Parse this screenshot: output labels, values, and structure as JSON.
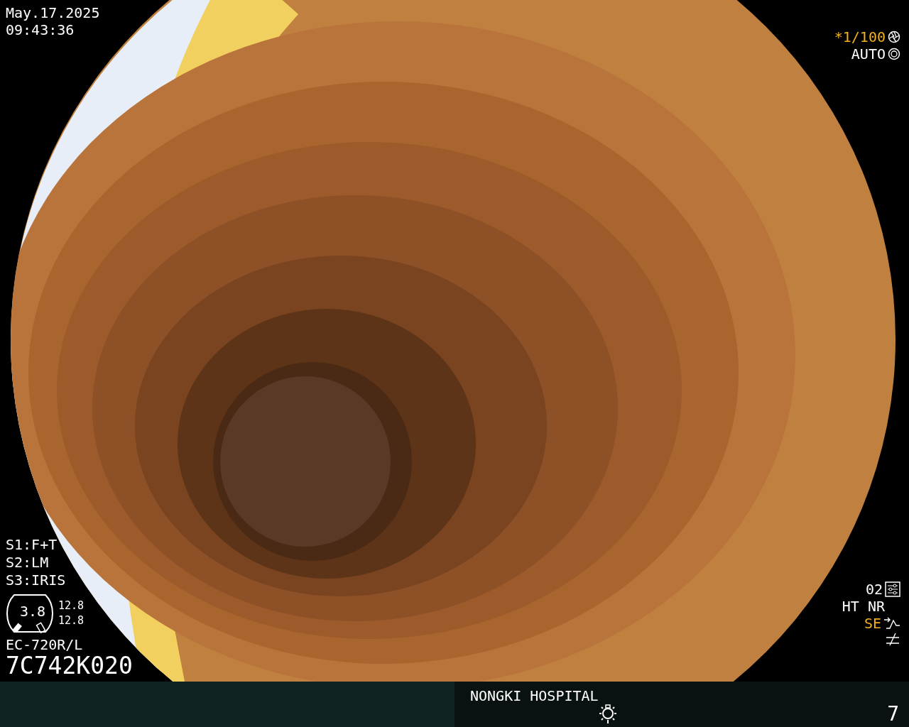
{
  "header": {
    "date": "May.17.2025",
    "time": "09:43:36"
  },
  "exposure": {
    "shutter": "*1/100",
    "shutter_highlighted": true,
    "iris": "AUTO"
  },
  "switches": [
    "S1:F+T",
    "S2:LM",
    "S3:IRIS"
  ],
  "gauge": {
    "value": "3.8",
    "readings": [
      "12.8",
      "12.8"
    ]
  },
  "scope": {
    "model": "EC-720R/L",
    "serial": "7C742K020"
  },
  "modes": {
    "preset": "02",
    "enhance": "HT NR",
    "structure": "SE",
    "structure_highlighted": true
  },
  "footer": {
    "hospital": "NONGKI HOSPITAL",
    "counter": "7"
  }
}
